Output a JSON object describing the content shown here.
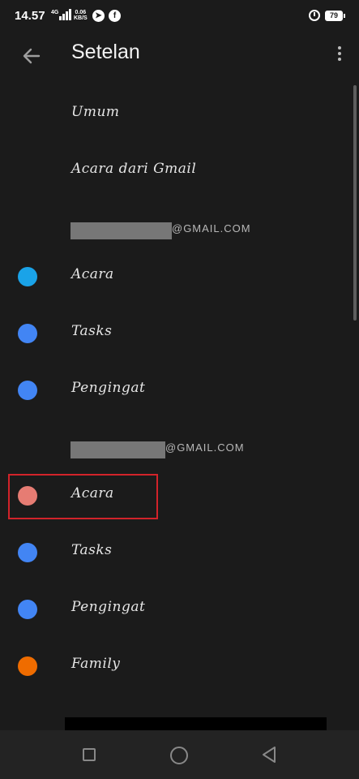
{
  "status_bar": {
    "time": "14.57",
    "network_label": "4G",
    "speed_value": "0.06",
    "speed_unit": "KB/S",
    "battery_level": "79",
    "app_icons": [
      "telegram-icon",
      "facebook-icon"
    ]
  },
  "app_bar": {
    "title": "Setelan",
    "back_icon": "arrow-left-icon",
    "menu_icon": "more-vert-icon"
  },
  "general": [
    {
      "label": "Umum"
    },
    {
      "label": "Acara dari Gmail"
    }
  ],
  "accounts": [
    {
      "email_suffix": "@GMAIL.COM",
      "calendars": [
        {
          "label": "Acara",
          "color": "#1aa3e8"
        },
        {
          "label": "Tasks",
          "color": "#4285f4"
        },
        {
          "label": "Pengingat",
          "color": "#4285f4"
        }
      ]
    },
    {
      "email_suffix": "@GMAIL.COM",
      "calendars": [
        {
          "label": "Acara",
          "color": "#e67c73"
        },
        {
          "label": "Tasks",
          "color": "#4285f4"
        },
        {
          "label": "Pengingat",
          "color": "#4285f4"
        },
        {
          "label": "Family",
          "color": "#ef6c00"
        }
      ]
    }
  ],
  "colors": {
    "background": "#1b1b1b",
    "highlight": "#d2232a",
    "nav_bar": "#232323"
  },
  "nav_icons": [
    "recent-apps-icon",
    "home-icon",
    "back-icon"
  ]
}
